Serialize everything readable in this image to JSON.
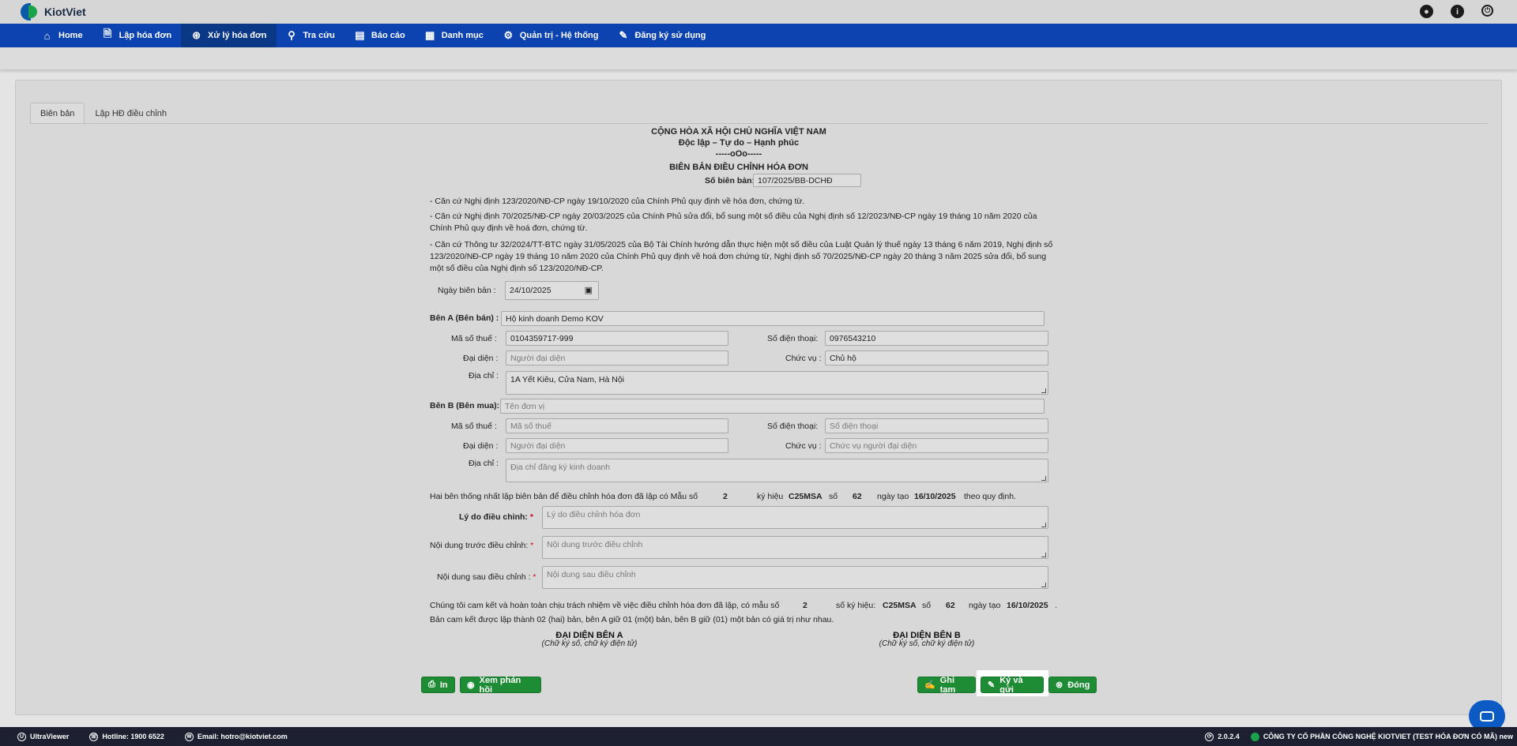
{
  "brand": {
    "name": "KiotViet"
  },
  "nav": {
    "items": [
      {
        "label": "Home",
        "icon": "home-icon"
      },
      {
        "label": "Lập hóa đơn",
        "icon": "invoice-icon"
      },
      {
        "label": "Xử lý hóa đơn",
        "icon": "process-icon"
      },
      {
        "label": "Tra cứu",
        "icon": "search-icon"
      },
      {
        "label": "Báo cáo",
        "icon": "report-icon"
      },
      {
        "label": "Danh mục",
        "icon": "grid-icon"
      },
      {
        "label": "Quản trị - Hệ thống",
        "icon": "settings-icon"
      },
      {
        "label": "Đăng ký sử dụng",
        "icon": "register-icon"
      }
    ],
    "active_index": 2
  },
  "tabs": [
    {
      "label": "Biên bản"
    },
    {
      "label": "Lập HĐ điều chỉnh"
    }
  ],
  "doc": {
    "header1": "CỘNG HÒA XÃ HỘI CHỦ NGHĨA VIỆT NAM",
    "header2": "Độc lập – Tự do – Hạnh phúc",
    "header3": "-----oOo-----",
    "title": "BIÊN BẢN ĐIỀU CHỈNH HÓA ĐƠN",
    "so_label": "Số biên bản:",
    "so_value": "107/2025/BB-DCHĐ",
    "basis1": "- Căn cứ Nghị định 123/2020/NĐ-CP ngày 19/10/2020 của Chính Phủ quy định về hóa đơn, chứng từ.",
    "basis2a": "- Căn cứ Nghị định 70/2025/NĐ-CP ngày 20/03/2025 của Chính Phủ sửa đổi, bổ sung một số điều của Nghị định số 12/2023/NĐ-CP ngày 19 tháng 10 năm 2020 của",
    "basis2b": "Chính Phủ quy định về hoá đơn, chứng từ.",
    "basis3a": "- Căn cứ Thông tư 32/2024/TT-BTC ngày 31/05/2025 của Bộ Tài Chính hướng dẫn thực hiện một số điều của Luật Quản lý thuế ngày 13 tháng 6 năm 2019, Nghị định số",
    "basis3b": "123/2020/NĐ-CP ngày 19 tháng 10 năm 2020 của Chính Phủ quy định về hoá đơn chứng từ, Nghị định số 70/2025/NĐ-CP ngày 20 tháng 3 năm 2025 sửa đổi, bổ sung",
    "basis3c": "một số điều của Nghị định số 123/2020/NĐ-CP.",
    "date_label": "Ngày biên bản :",
    "date_value": "24/10/2025",
    "party_a": {
      "label": "Bên A (Bên bán) :",
      "name": "Hộ kinh doanh Demo KOV",
      "tax_label": "Mã số thuế :",
      "tax": "0104359717-999",
      "phone_label": "Số điện thoại:",
      "phone": "0976543210",
      "rep_label": "Đại diện :",
      "rep_placeholder": "Người đại diện",
      "pos_label": "Chức vụ :",
      "pos": "Chủ hộ",
      "addr_label": "Địa chỉ :",
      "addr": "1A Yết Kiêu, Cửa Nam, Hà Nội"
    },
    "party_b": {
      "label": "Bên B (Bên mua):",
      "name_placeholder": "Tên đơn vị",
      "tax_label": "Mã số thuế :",
      "tax_placeholder": "Mã số thuế",
      "phone_label": "Số điện thoại:",
      "phone_placeholder": "Số điện thoại",
      "rep_label": "Đại diện :",
      "rep_placeholder": "Người đại diện",
      "pos_label": "Chức vụ :",
      "pos_placeholder": "Chức vụ người đại diện",
      "addr_label": "Địa chỉ :",
      "addr_placeholder": "Địa chỉ đăng ký kinh doanh"
    },
    "agree": {
      "text1": "Hai bên thống nhất lập biên bản để điều chỉnh hóa đơn đã lập có Mẫu số",
      "mau_so": "2",
      "kh_label": "ký hiệu",
      "ky_hieu": "C25MSA",
      "so_label": "số",
      "so": "62",
      "ngay_label": "ngày tạo",
      "ngay": "16/10/2025",
      "tail": "theo quy định."
    },
    "reason_label": "Lý do điều chỉnh:",
    "reason_placeholder": "Lý do điều chỉnh hóa đơn",
    "before_label": "Nội dung trước điều chỉnh:",
    "before_placeholder": "Nội dung trước điều chỉnh",
    "after_label": "Nội dung sau điều chỉnh :",
    "after_placeholder": "Nội dung sau điều chỉnh",
    "commit": {
      "text1": "Chúng tôi cam kết và hoàn toàn chịu trách nhiệm về việc điều chỉnh hóa đơn đã lập, có mẫu số",
      "mau_so": "2",
      "kh_label": "số ký hiệu:",
      "ky_hieu": "C25MSA",
      "so_label": "số",
      "so": "62",
      "ngay_label": "ngày tạo",
      "ngay": "16/10/2025",
      "end": ".",
      "line2": "Bản cam kết được lập thành 02 (hai) bản, bên A giữ 01 (một) bản, bên B giữ (01) một bản có giá trị như nhau."
    },
    "sign_a": {
      "title": "ĐẠI DIỆN BÊN A",
      "sub": "(Chữ ký số, chữ ký điện tử)"
    },
    "sign_b": {
      "title": "ĐẠI DIỆN BÊN B",
      "sub": "(Chữ ký số, chữ ký điện tử)"
    },
    "required_mark": "*"
  },
  "buttons": {
    "print": "In",
    "feedback": "Xem phản hồi",
    "save_draft": "Ghi tạm",
    "sign_send": "Ký và gửi",
    "close": "Đóng"
  },
  "footer": {
    "ultraviewer": "UltraViewer",
    "hotline": "Hotline: 1900 6522",
    "email": "Email: hotro@kiotviet.com",
    "version": "2.0.2.4",
    "company": "CÔNG TY CỔ PHẦN CÔNG NGHỆ KIOTVIET (TEST HÓA ĐƠN CÓ MÃ) new"
  },
  "colors": {
    "nav": "#0c43b0",
    "button": "#1e8c34",
    "footer": "#1c2030"
  }
}
